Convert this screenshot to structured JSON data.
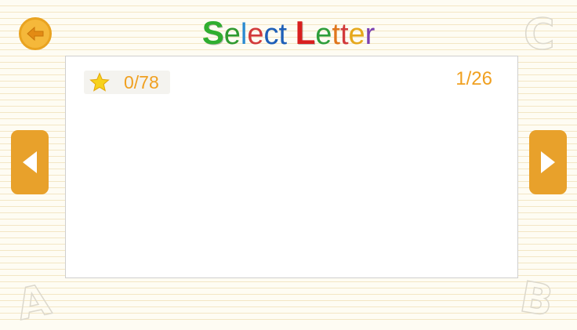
{
  "header": {
    "title_parts": [
      {
        "text": "S",
        "color": "#2fae2f"
      },
      {
        "text": "e",
        "color": "#2f9a2f"
      },
      {
        "text": "l",
        "color": "#2a8ad0"
      },
      {
        "text": "e",
        "color": "#d23a3a"
      },
      {
        "text": "c",
        "color": "#1e5fb8"
      },
      {
        "text": "t",
        "color": "#1e5fb8"
      },
      {
        "text": " ",
        "color": "#000000"
      },
      {
        "text": "L",
        "color": "#d91f1f"
      },
      {
        "text": "e",
        "color": "#2e9e3b"
      },
      {
        "text": "t",
        "color": "#e0761c"
      },
      {
        "text": "t",
        "color": "#d23a3a"
      },
      {
        "text": "e",
        "color": "#e6a81c"
      },
      {
        "text": "r",
        "color": "#7b3fb0"
      }
    ],
    "back_icon": "back-arrow-icon"
  },
  "score": {
    "icon": "star-icon",
    "value": "0/78"
  },
  "pager": {
    "value": "1/26",
    "prev_icon": "triangle-left-icon",
    "next_icon": "triangle-right-icon"
  },
  "decorations": {
    "letters": [
      "C",
      "A",
      "B"
    ]
  },
  "colors": {
    "accent": "#e8a12b",
    "text_accent": "#f0a020"
  }
}
